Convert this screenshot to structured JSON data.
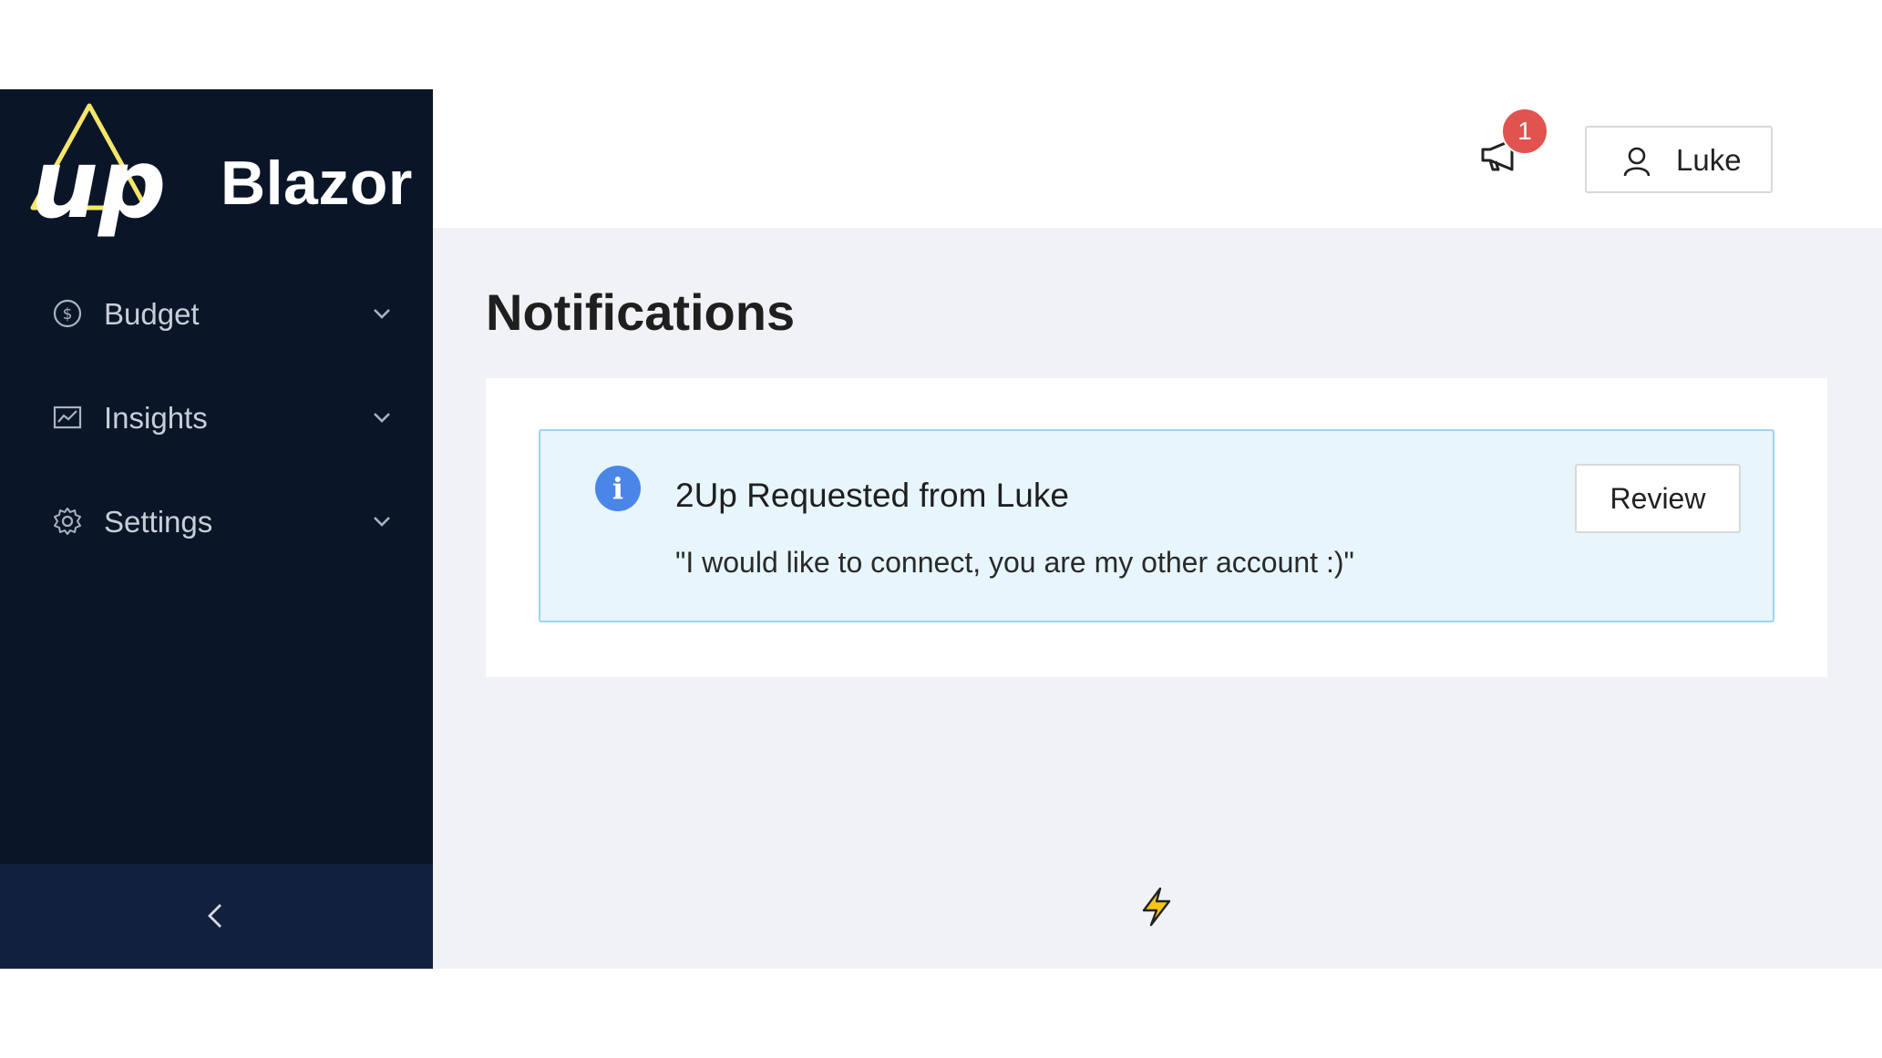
{
  "brand": {
    "name": "Blazor",
    "logo_text": "up"
  },
  "sidebar": {
    "items": [
      {
        "label": "Budget",
        "icon": "dollar-circle-icon"
      },
      {
        "label": "Insights",
        "icon": "line-chart-icon"
      },
      {
        "label": "Settings",
        "icon": "gear-icon"
      }
    ],
    "collapse_icon": "chevron-left-icon"
  },
  "header": {
    "notification_count": "1",
    "notification_icon": "megaphone-icon",
    "user_name": "Luke",
    "user_icon": "user-icon"
  },
  "page": {
    "title": "Notifications"
  },
  "notifications": [
    {
      "type": "info",
      "title": "2Up Requested from Luke",
      "message": "\"I would like to connect, you are my other account :)\"",
      "action_label": "Review"
    }
  ],
  "footer": {
    "icon": "lightning-icon"
  },
  "colors": {
    "sidebar_bg": "#0a1628",
    "collapse_bg": "#11203d",
    "badge": "#e0534f",
    "info_blue": "#4a86e8",
    "alert_bg": "#e7f5fd",
    "logo_yellow": "#f5e66b",
    "bolt_yellow": "#f5c518"
  }
}
